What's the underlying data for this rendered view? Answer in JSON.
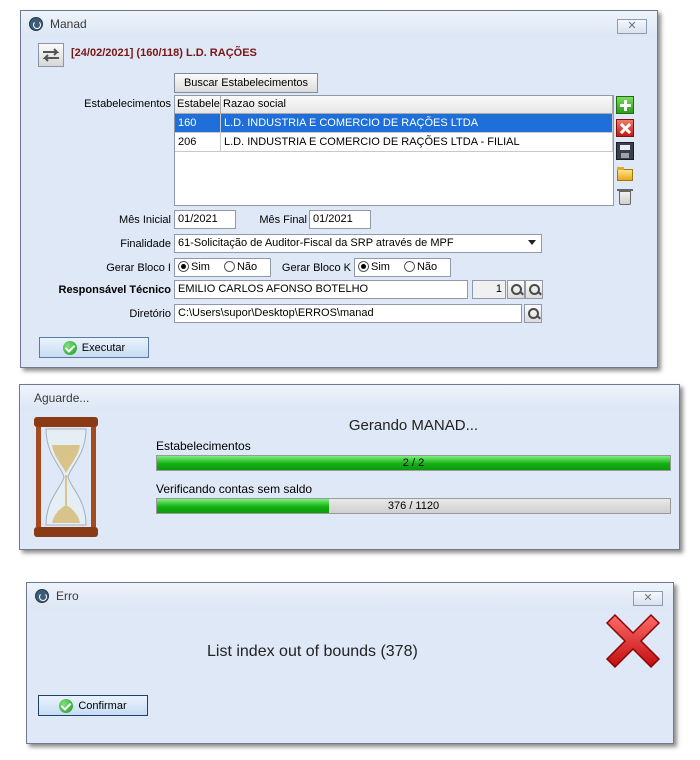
{
  "manad": {
    "title": "Manad",
    "close": "✕",
    "header": "[24/02/2021] (160/118) L.D. RAÇÕES",
    "buscar_label": "Buscar Estabelecimentos",
    "estab_label": "Estabelecimentos",
    "grid": {
      "columns": [
        "Estabelec",
        "Razao social"
      ],
      "rows": [
        {
          "code": "160",
          "name": "L.D. INDUSTRIA E COMERCIO DE RAÇÕES LTDA"
        },
        {
          "code": "206",
          "name": "L.D. INDUSTRIA E COMERCIO DE RAÇÕES LTDA - FILIAL"
        }
      ]
    },
    "mes_inicial_label": "Mês Inicial",
    "mes_inicial": "01/2021",
    "mes_final_label": "Mês Final",
    "mes_final": "01/2021",
    "finalidade_label": "Finalidade",
    "finalidade": "61-Solicitação de Auditor-Fiscal da SRP através de MPF",
    "bloco_i_label": "Gerar Bloco I",
    "bloco_k_label": "Gerar Bloco K",
    "sim": "Sim",
    "nao": "Não",
    "responsavel_label": "Responsável Técnico",
    "responsavel": "EMILIO CARLOS AFONSO BOTELHO",
    "responsavel_num": "1",
    "diretorio_label": "Diretório",
    "diretorio": "C:\\Users\\supor\\Desktop\\ERROS\\manad",
    "executar": "Executar"
  },
  "aguarde": {
    "title": "Aguarde...",
    "heading": "Gerando MANAD...",
    "p1_label": "Estabelecimentos",
    "p1_text": "2 / 2",
    "p1_fraction": 1.0,
    "p2_label": "Verificando contas sem saldo",
    "p2_text": "376 / 1120",
    "p2_fraction": 0.3357
  },
  "erro": {
    "title": "Erro",
    "close": "✕",
    "message": "List index out of bounds (378)",
    "confirmar": "Confirmar"
  }
}
